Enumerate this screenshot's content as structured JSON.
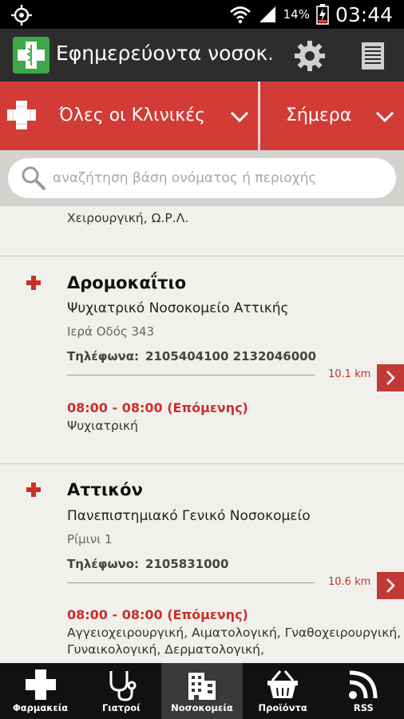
{
  "status_bar": {
    "battery": "14%",
    "time": "03:44"
  },
  "app_bar": {
    "title": "Εφημερεύοντα νοσοκ..."
  },
  "filters": {
    "clinics": "Όλες οι Κλινικές",
    "day": "Σήμερα"
  },
  "search": {
    "placeholder": "αναζήτηση βάση ονόματος ή περιοχής"
  },
  "partial_item": {
    "specialties": "Χειρουργική, Ω.Ρ.Λ."
  },
  "hospitals": [
    {
      "name": "Δρομοκαΐτιο",
      "subtitle": "Ψυχιατρικό Νοσοκομείο Αττικής",
      "address": "Ιερά Οδός 343",
      "phone_label": "Τηλέφωνα:",
      "phones": "2105404100 2132046000",
      "distance": "10.1 km",
      "hours": "08:00 - 08:00 (Επόμενης)",
      "specialties": "Ψυχιατρική"
    },
    {
      "name": "Αττικόν",
      "subtitle": "Πανεπιστημιακό Γενικό Νοσοκομείο",
      "address": "Ρίμινι 1",
      "phone_label": "Τηλέφωνο:",
      "phones": "2105831000",
      "distance": "10.6 km",
      "hours": "08:00 - 08:00 (Επόμενης)",
      "specialties": "Αγγειοχειρουργική, Αιματολογική, Γναθοχειρουργική, Γυναικολογική, Δερματολογική,"
    }
  ],
  "bottom_nav": [
    {
      "label": "Φαρμακεία",
      "icon": "pharmacy-cross-icon"
    },
    {
      "label": "Γιατροί",
      "icon": "stethoscope-icon"
    },
    {
      "label": "Νοσοκομεία",
      "icon": "hospital-building-icon"
    },
    {
      "label": "Προϊόντα",
      "icon": "shopping-basket-icon"
    },
    {
      "label": "RSS",
      "icon": "rss-icon"
    }
  ],
  "colors": {
    "accent_red": "#d23b36",
    "app_bar": "#2d2d2d",
    "logo_green": "#3fa74a"
  }
}
